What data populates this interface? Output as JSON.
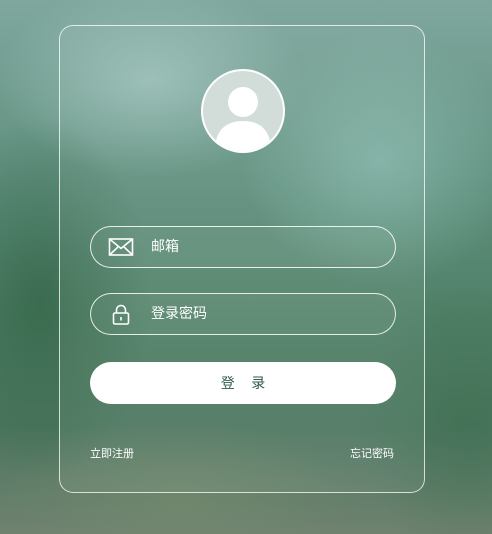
{
  "avatar": {
    "icon": "user-avatar-icon"
  },
  "email_field": {
    "placeholder": "邮箱",
    "value": "",
    "icon": "envelope-icon"
  },
  "password_field": {
    "placeholder": "登录密码",
    "value": "",
    "icon": "lock-icon"
  },
  "login_button": {
    "label": "登 录"
  },
  "links": {
    "register": "立即注册",
    "forgot_password": "忘记密码"
  },
  "colors": {
    "button_text": "#2f5b49",
    "border": "#ffffff",
    "avatar_bg": "#d2dcd8"
  }
}
